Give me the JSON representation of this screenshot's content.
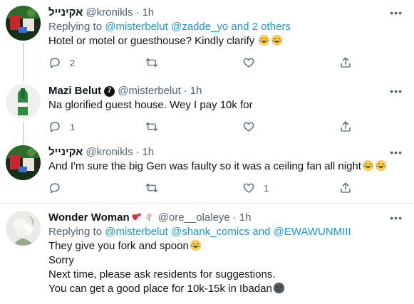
{
  "tweets": [
    {
      "display_name": "אקינייל",
      "handle": "@kronikls",
      "time": "1h",
      "verified_mark": "",
      "replying_prefix": "Replying to ",
      "replying_mentions": "@misterbelut @zadde_yo and 2 others",
      "text": "Hotel or motel or guesthouse? Kindly clarify",
      "trailing_emoji": [
        "tears-of-joy",
        "tears-of-joy"
      ],
      "reply_count": "2",
      "retweet_count": "",
      "like_count": ""
    },
    {
      "display_name": "Mazi Belut",
      "handle": "@misterbelut",
      "time": "1h",
      "verified_mark": "7",
      "text": "Na glorified guest house. Wey I pay 10k for",
      "trailing_emoji": [],
      "reply_count": "1",
      "retweet_count": "",
      "like_count": ""
    },
    {
      "display_name": "אקינייל",
      "handle": "@kronikls",
      "time": "1h",
      "verified_mark": "",
      "text": "And I'm sure the big Gen was faulty so it was a ceiling fan all night",
      "trailing_emoji": [
        "tears-of-joy",
        "tears-of-joy"
      ],
      "reply_count": "",
      "retweet_count": "",
      "like_count": "1"
    },
    {
      "display_name": "Wonder Woman",
      "name_emoji": [
        "two-hearts",
        "tulip"
      ],
      "handle": "@ore__olaleye",
      "time": "1h",
      "verified_mark": "",
      "replying_prefix": "Replying to ",
      "replying_mentions": "@misterbelut @shank_comics and @EWAWUNMIII",
      "lines": [
        "They give you fork and spoon",
        "Sorry",
        "Next time, please ask residents for suggestions.",
        "You can get a good place for 10k-15k in Ibadan"
      ],
      "line_emoji": [
        "tears-of-joy",
        "",
        "",
        "new-moon-face"
      ]
    }
  ],
  "separator": "·",
  "more_label": "•••",
  "icons": {
    "reply": "reply-icon",
    "retweet": "retweet-icon",
    "like": "heart-icon",
    "share": "share-icon",
    "more": "more-icon"
  },
  "colors": {
    "text": "#0f1419",
    "secondary": "#536471",
    "mention": "#1b95e0",
    "divider": "#e6ecf0",
    "thread_line": "#cfd9de"
  }
}
